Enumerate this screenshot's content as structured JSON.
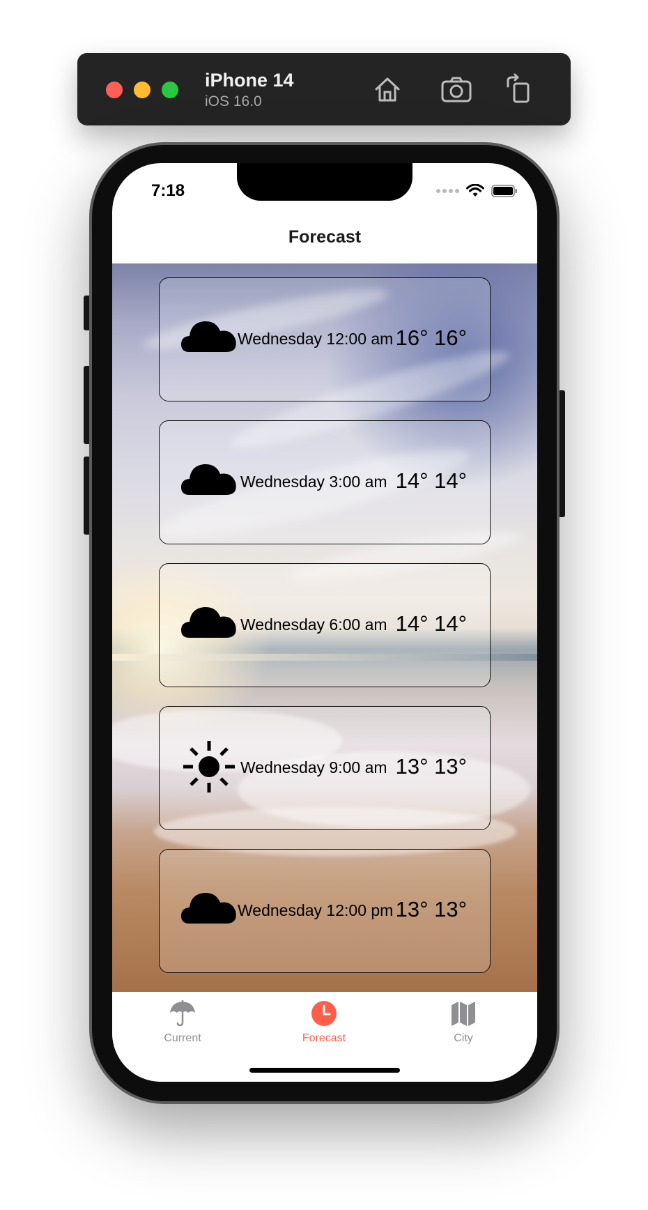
{
  "simulator": {
    "device_name": "iPhone 14",
    "os_version": "iOS 16.0",
    "buttons": [
      "home-icon",
      "screenshot-icon",
      "rotate-icon"
    ]
  },
  "status_bar": {
    "time": "7:18"
  },
  "nav": {
    "title": "Forecast"
  },
  "forecast": [
    {
      "icon": "cloud-icon",
      "label": "Wednesday 12:00 am",
      "temps": "16° 16°"
    },
    {
      "icon": "cloud-icon",
      "label": "Wednesday 3:00 am",
      "temps": "14° 14°"
    },
    {
      "icon": "cloud-icon",
      "label": "Wednesday 6:00 am",
      "temps": "14° 14°"
    },
    {
      "icon": "sun-icon",
      "label": "Wednesday 9:00 am",
      "temps": "13° 13°"
    },
    {
      "icon": "cloud-icon",
      "label": "Wednesday 12:00 pm",
      "temps": "13° 13°"
    }
  ],
  "tabs": [
    {
      "icon": "umbrella-icon",
      "label": "Current",
      "selected": false
    },
    {
      "icon": "clock-icon",
      "label": "Forecast",
      "selected": true
    },
    {
      "icon": "map-icon",
      "label": "City",
      "selected": false
    }
  ],
  "colors": {
    "accent": "#ff5f4a",
    "tab_inactive": "#8e8e93",
    "sim_bar": "#242424"
  }
}
